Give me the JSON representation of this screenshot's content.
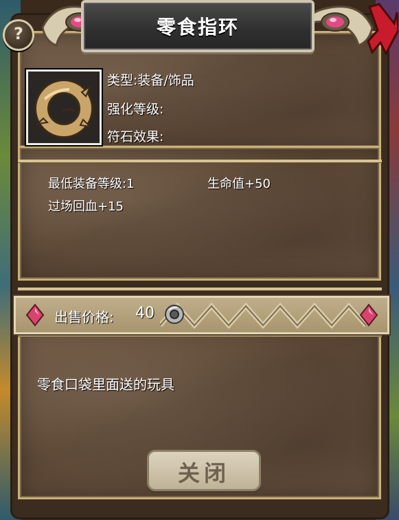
{
  "dialog": {
    "title": "零食指环",
    "help_glyph": "?",
    "item_icon": "ring-icon",
    "info": {
      "type": "类型:装备/饰品",
      "enhance": "强化等级:",
      "rune": "符石效果:"
    },
    "stats": {
      "min_level": "最低装备等级:1",
      "hp": "生命值+50",
      "regen": "过场回血+15"
    },
    "price": {
      "label": "出售价格:",
      "value": "40",
      "currency_icon": "coin-icon"
    },
    "description": "零食口袋里面送的玩具",
    "close_label": "关闭"
  },
  "colors": {
    "gold_frame": "#c9b07a",
    "parchment": "#5a4534",
    "gem": "#d8446e",
    "close_x": "#c81c2c"
  }
}
